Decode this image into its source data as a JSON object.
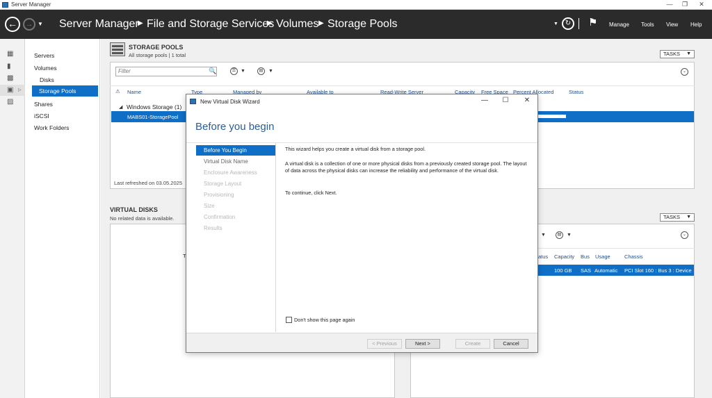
{
  "window": {
    "title": "Server Manager",
    "controls": [
      "—",
      "❐",
      "✕"
    ]
  },
  "header": {
    "breadcrumb": [
      "Server Manager",
      "File and Storage Services",
      "Volumes",
      "Storage Pools"
    ],
    "menu": [
      "Manage",
      "Tools",
      "View",
      "Help"
    ]
  },
  "nav": {
    "items": [
      "Servers",
      "Volumes",
      "Disks",
      "Storage Pools",
      "Shares",
      "iSCSI",
      "Work Folders"
    ]
  },
  "storage_pools": {
    "title": "STORAGE POOLS",
    "subtitle": "All storage pools | 1 total",
    "tasks_label": "TASKS",
    "filter_placeholder": "Filter",
    "columns": [
      "Name",
      "Type",
      "Managed by",
      "Available to",
      "Read-Write Server",
      "Capacity",
      "Free Space",
      "Percent Allocated",
      "Status"
    ],
    "group_label": "Windows Storage (1)",
    "row_name": "MABS01-StoragePool",
    "last_refreshed": "Last refreshed on 03.05.2025"
  },
  "virtual_disks": {
    "title": "VIRTUAL DISKS",
    "subtitle": "No related data is available.",
    "partial_text": "T"
  },
  "physical_disks": {
    "tasks_label": "TASKS",
    "columns": [
      "Status",
      "Capacity",
      "Bus",
      "Usage",
      "Chassis"
    ],
    "columns_visible": [
      "atus",
      "Capacity",
      "Bus",
      "Usage",
      "Chassis"
    ],
    "row": {
      "capacity": "100 GB",
      "bus": "SAS",
      "usage": "Automatic",
      "chassis": "PCI Slot 160 : Bus 3 : Device"
    }
  },
  "dialog": {
    "title": "New Virtual Disk Wizard",
    "heading": "Before you begin",
    "steps": [
      "Before You Begin",
      "Virtual Disk Name",
      "Enclosure Awareness",
      "Storage Layout",
      "Provisioning",
      "Size",
      "Confirmation",
      "Results"
    ],
    "para1": "This wizard helps you create a virtual disk from a storage pool.",
    "para2": "A virtual disk is a collection of one or more physical disks from a previously created storage pool. The layout of data across the physical disks can increase the reliability and performance of the virtual disk.",
    "para3": "To continue, click Next.",
    "checkbox_label": "Don't show this page again",
    "buttons": {
      "previous": "< Previous",
      "next": "Next >",
      "create": "Create",
      "cancel": "Cancel"
    }
  },
  "colors": {
    "accent": "#0f6fc6",
    "header_bg": "#2b2b2b",
    "heading": "#2a5d97"
  }
}
